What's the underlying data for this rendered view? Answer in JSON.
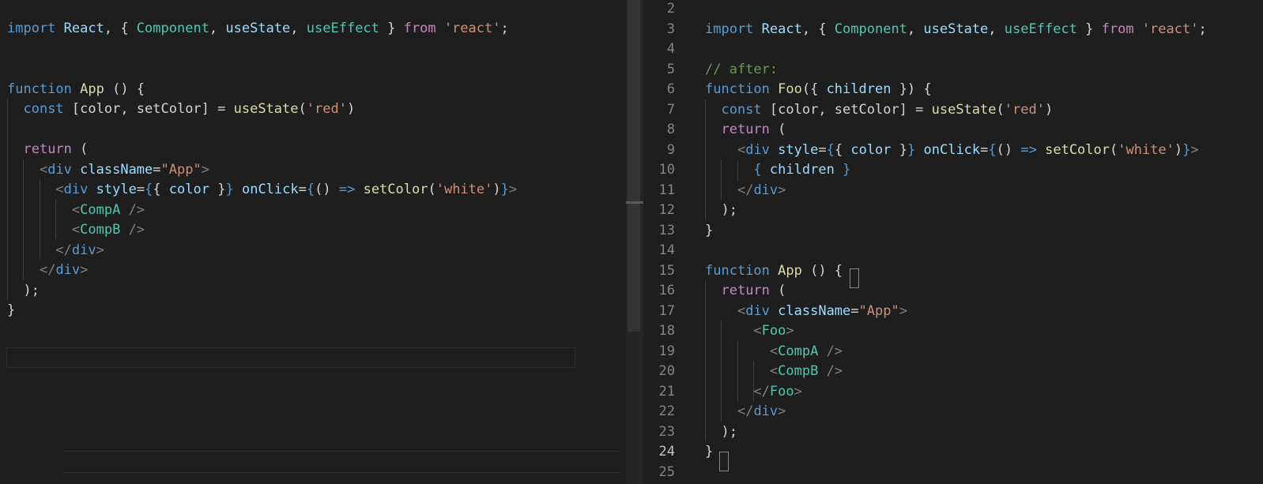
{
  "left_editor": {
    "lines": [
      [
        [
          "kw",
          "import "
        ],
        [
          "var",
          "React"
        ],
        [
          "plain",
          ", { "
        ],
        [
          "cls",
          "Component"
        ],
        [
          "plain",
          ", "
        ],
        [
          "var",
          "useState"
        ],
        [
          "plain",
          ", "
        ],
        [
          "cls",
          "useEffect"
        ],
        [
          "plain",
          " } "
        ],
        [
          "ctl",
          "from "
        ],
        [
          "str",
          "'react'"
        ],
        [
          "plain",
          ";"
        ]
      ],
      [],
      [],
      [
        [
          "kw",
          "function "
        ],
        [
          "fn",
          "App"
        ],
        [
          "plain",
          " () {"
        ]
      ],
      [
        [
          "plain",
          "  "
        ],
        [
          "kw",
          "const "
        ],
        [
          "plain",
          "[color, setColor] = "
        ],
        [
          "fn",
          "useState"
        ],
        [
          "plain",
          "("
        ],
        [
          "str",
          "'red'"
        ],
        [
          "plain",
          ")"
        ]
      ],
      [],
      [
        [
          "plain",
          "  "
        ],
        [
          "ctl",
          "return"
        ],
        [
          "plain",
          " ("
        ]
      ],
      [
        [
          "plain",
          "    "
        ],
        [
          "brk",
          "<"
        ],
        [
          "tag",
          "div "
        ],
        [
          "var",
          "className"
        ],
        [
          "plain",
          "="
        ],
        [
          "str",
          "\"App\""
        ],
        [
          "brk",
          ">"
        ]
      ],
      [
        [
          "plain",
          "      "
        ],
        [
          "brk",
          "<"
        ],
        [
          "tag",
          "div "
        ],
        [
          "var",
          "style"
        ],
        [
          "plain",
          "="
        ],
        [
          "kw",
          "{"
        ],
        [
          "plain",
          "{ "
        ],
        [
          "var",
          "color"
        ],
        [
          "plain",
          " }"
        ],
        [
          "kw",
          "}"
        ],
        [
          "plain",
          " "
        ],
        [
          "var",
          "onClick"
        ],
        [
          "plain",
          "="
        ],
        [
          "kw",
          "{"
        ],
        [
          "plain",
          "() "
        ],
        [
          "kw",
          "=>"
        ],
        [
          "plain",
          " "
        ],
        [
          "fn",
          "setColor"
        ],
        [
          "plain",
          "("
        ],
        [
          "str",
          "'white'"
        ],
        [
          "plain",
          ")"
        ],
        [
          "kw",
          "}"
        ],
        [
          "brk",
          ">"
        ]
      ],
      [
        [
          "plain",
          "        "
        ],
        [
          "brk",
          "<"
        ],
        [
          "comp",
          "CompA"
        ],
        [
          "brk",
          " />"
        ]
      ],
      [
        [
          "plain",
          "        "
        ],
        [
          "brk",
          "<"
        ],
        [
          "comp",
          "CompB"
        ],
        [
          "brk",
          " />"
        ]
      ],
      [
        [
          "plain",
          "      "
        ],
        [
          "brk",
          "</"
        ],
        [
          "tag",
          "div"
        ],
        [
          "brk",
          ">"
        ]
      ],
      [
        [
          "plain",
          "    "
        ],
        [
          "brk",
          "</"
        ],
        [
          "tag",
          "div"
        ],
        [
          "brk",
          ">"
        ]
      ],
      [
        [
          "plain",
          "  );"
        ]
      ],
      [
        [
          "plain",
          "}"
        ]
      ]
    ]
  },
  "right_editor": {
    "line_numbers": [
      "2",
      "3",
      "4",
      "5",
      "6",
      "7",
      "8",
      "9",
      "10",
      "11",
      "12",
      "13",
      "14",
      "15",
      "16",
      "17",
      "18",
      "19",
      "20",
      "21",
      "22",
      "23",
      "24",
      "25"
    ],
    "active_line": "24",
    "lines": [
      [],
      [
        [
          "kw",
          "import "
        ],
        [
          "var",
          "React"
        ],
        [
          "plain",
          ", { "
        ],
        [
          "cls",
          "Component"
        ],
        [
          "plain",
          ", "
        ],
        [
          "var",
          "useState"
        ],
        [
          "plain",
          ", "
        ],
        [
          "cls",
          "useEffect"
        ],
        [
          "plain",
          " } "
        ],
        [
          "ctl",
          "from "
        ],
        [
          "str",
          "'react'"
        ],
        [
          "plain",
          ";"
        ]
      ],
      [],
      [
        [
          "cmt",
          "// after:"
        ]
      ],
      [
        [
          "kw",
          "function "
        ],
        [
          "fn",
          "Foo"
        ],
        [
          "plain",
          "({ "
        ],
        [
          "var",
          "children"
        ],
        [
          "plain",
          " }) {"
        ]
      ],
      [
        [
          "plain",
          "  "
        ],
        [
          "kw",
          "const "
        ],
        [
          "plain",
          "[color, setColor] = "
        ],
        [
          "fn",
          "useState"
        ],
        [
          "plain",
          "("
        ],
        [
          "str",
          "'red'"
        ],
        [
          "plain",
          ")"
        ]
      ],
      [
        [
          "plain",
          "  "
        ],
        [
          "ctl",
          "return"
        ],
        [
          "plain",
          " ("
        ]
      ],
      [
        [
          "plain",
          "    "
        ],
        [
          "brk",
          "<"
        ],
        [
          "tag",
          "div "
        ],
        [
          "var",
          "style"
        ],
        [
          "plain",
          "="
        ],
        [
          "kw",
          "{"
        ],
        [
          "plain",
          "{ "
        ],
        [
          "var",
          "color"
        ],
        [
          "plain",
          " }"
        ],
        [
          "kw",
          "}"
        ],
        [
          "plain",
          " "
        ],
        [
          "var",
          "onClick"
        ],
        [
          "plain",
          "="
        ],
        [
          "kw",
          "{"
        ],
        [
          "plain",
          "() "
        ],
        [
          "kw",
          "=>"
        ],
        [
          "plain",
          " "
        ],
        [
          "fn",
          "setColor"
        ],
        [
          "plain",
          "("
        ],
        [
          "str",
          "'white'"
        ],
        [
          "plain",
          ")"
        ],
        [
          "kw",
          "}"
        ],
        [
          "brk",
          ">"
        ]
      ],
      [
        [
          "plain",
          "      "
        ],
        [
          "kw",
          "{"
        ],
        [
          "plain",
          " "
        ],
        [
          "var",
          "children"
        ],
        [
          "plain",
          " "
        ],
        [
          "kw",
          "}"
        ]
      ],
      [
        [
          "plain",
          "    "
        ],
        [
          "brk",
          "</"
        ],
        [
          "tag",
          "div"
        ],
        [
          "brk",
          ">"
        ]
      ],
      [
        [
          "plain",
          "  );"
        ]
      ],
      [
        [
          "plain",
          "}"
        ]
      ],
      [],
      [
        [
          "kw",
          "function "
        ],
        [
          "fn",
          "App"
        ],
        [
          "plain",
          " () {"
        ]
      ],
      [
        [
          "plain",
          "  "
        ],
        [
          "ctl",
          "return"
        ],
        [
          "plain",
          " ("
        ]
      ],
      [
        [
          "plain",
          "    "
        ],
        [
          "brk",
          "<"
        ],
        [
          "tag",
          "div "
        ],
        [
          "var",
          "className"
        ],
        [
          "plain",
          "="
        ],
        [
          "str",
          "\"App\""
        ],
        [
          "brk",
          ">"
        ]
      ],
      [
        [
          "plain",
          "      "
        ],
        [
          "brk",
          "<"
        ],
        [
          "comp",
          "Foo"
        ],
        [
          "brk",
          ">"
        ]
      ],
      [
        [
          "plain",
          "        "
        ],
        [
          "brk",
          "<"
        ],
        [
          "comp",
          "CompA"
        ],
        [
          "brk",
          " />"
        ]
      ],
      [
        [
          "plain",
          "        "
        ],
        [
          "brk",
          "<"
        ],
        [
          "comp",
          "CompB"
        ],
        [
          "brk",
          " />"
        ]
      ],
      [
        [
          "plain",
          "      "
        ],
        [
          "brk",
          "</"
        ],
        [
          "comp",
          "Foo"
        ],
        [
          "brk",
          ">"
        ]
      ],
      [
        [
          "plain",
          "    "
        ],
        [
          "brk",
          "</"
        ],
        [
          "tag",
          "div"
        ],
        [
          "brk",
          ">"
        ]
      ],
      [
        [
          "plain",
          "  );"
        ]
      ],
      [
        [
          "plain",
          "}"
        ]
      ],
      []
    ]
  }
}
